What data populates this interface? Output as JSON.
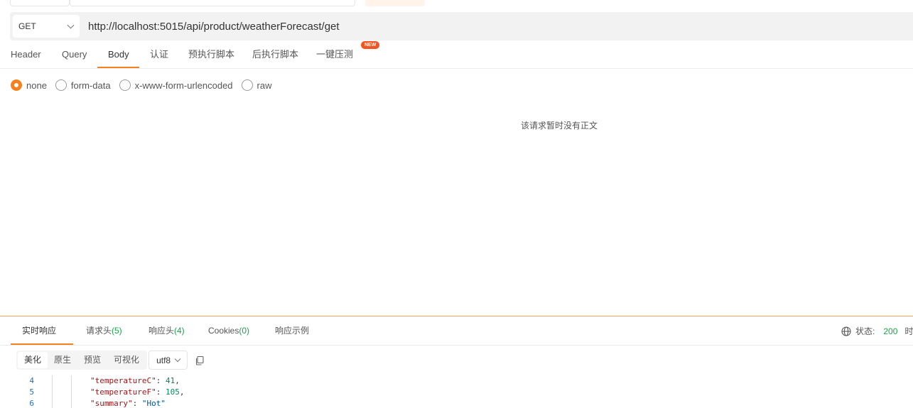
{
  "url_bar": {
    "method": "GET",
    "url": "http://localhost:5015/api/product/weatherForecast/get"
  },
  "request_tabs": {
    "header": "Header",
    "query": "Query",
    "body": "Body",
    "auth": "认证",
    "pre_script": "预执行脚本",
    "post_script": "后执行脚本",
    "stress_test": "一键压测",
    "new_badge": "NEW"
  },
  "body_types": {
    "none": "none",
    "form_data": "form-data",
    "urlencoded": "x-www-form-urlencoded",
    "raw": "raw",
    "selected": "none"
  },
  "empty_body_message": "该请求暂时没有正文",
  "response_tabs": {
    "realtime": "实时响应",
    "request_headers": "请求头",
    "request_headers_count": "(5)",
    "response_headers": "响应头",
    "response_headers_count": "(4)",
    "cookies": "Cookies",
    "cookies_count": "(0)",
    "examples": "响应示例"
  },
  "status": {
    "label": "状态:",
    "code": "200",
    "time_label": "时"
  },
  "view_modes": {
    "pretty": "美化",
    "raw": "原生",
    "preview": "预览",
    "visualize": "可视化",
    "encoding": "utf8"
  },
  "code_lines": [
    {
      "num": "4",
      "key": "\"temperatureC\"",
      "sep": ": ",
      "value": "41",
      "trail": ",",
      "type": "num"
    },
    {
      "num": "5",
      "key": "\"temperatureF\"",
      "sep": ": ",
      "value": "105",
      "trail": ",",
      "type": "num"
    },
    {
      "num": "6",
      "key": "\"summary\"",
      "sep": ": ",
      "value": "\"Hot\"",
      "trail": "",
      "type": "str"
    }
  ],
  "colors": {
    "accent": "#f5821f",
    "success": "#1aa34a",
    "badge": "#f5541f"
  }
}
